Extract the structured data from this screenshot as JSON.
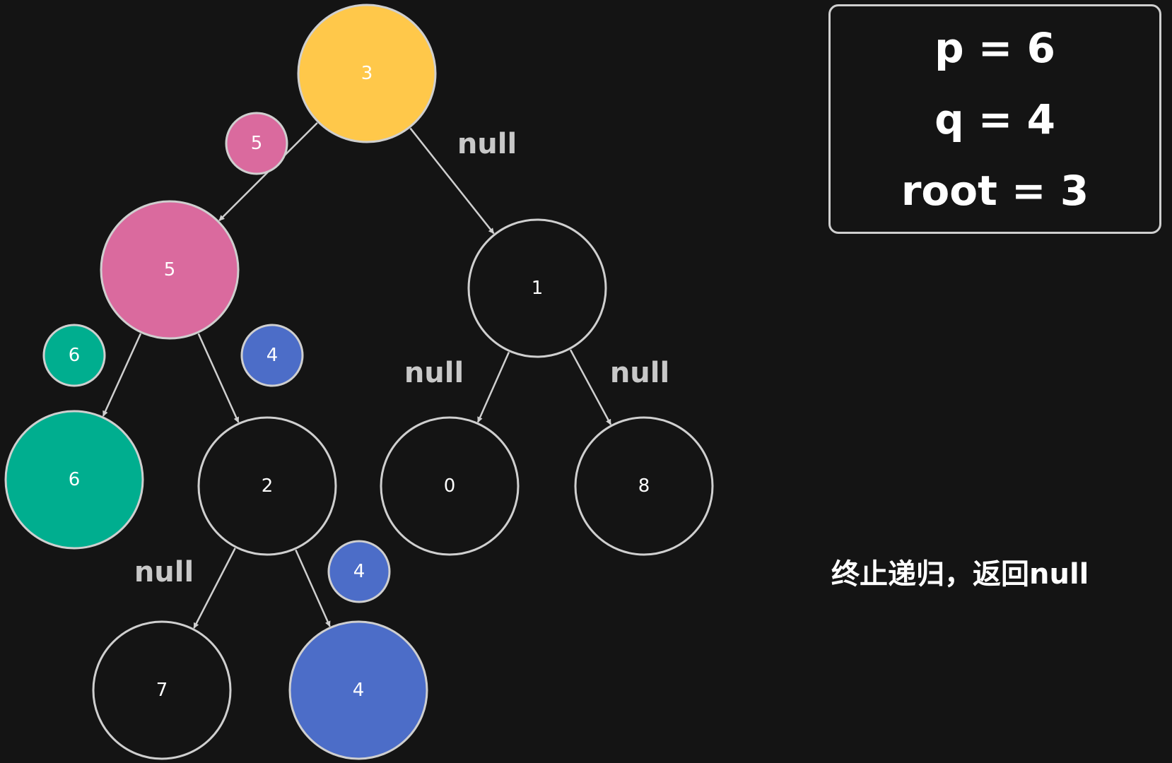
{
  "colors": {
    "background": "#141414",
    "stroke": "#cfcfcf",
    "root_yellow": "#FFC84A",
    "pink": "#DA6A9E",
    "green": "#00AE8F",
    "blue": "#4C6DC8"
  },
  "tree": {
    "nodes": [
      {
        "id": "n3",
        "label": "3",
        "fill": "#FFC84A"
      },
      {
        "id": "n5",
        "label": "5",
        "fill": "#DA6A9E"
      },
      {
        "id": "n1",
        "label": "1",
        "fill": "none"
      },
      {
        "id": "n6",
        "label": "6",
        "fill": "#00AE8F"
      },
      {
        "id": "n2",
        "label": "2",
        "fill": "none"
      },
      {
        "id": "n0",
        "label": "0",
        "fill": "none"
      },
      {
        "id": "n8",
        "label": "8",
        "fill": "none"
      },
      {
        "id": "n7",
        "label": "7",
        "fill": "none"
      },
      {
        "id": "n4",
        "label": "4",
        "fill": "#4C6DC8"
      }
    ],
    "edges": [
      {
        "from": "n3",
        "to": "n5"
      },
      {
        "from": "n3",
        "to": "n1"
      },
      {
        "from": "n5",
        "to": "n6"
      },
      {
        "from": "n5",
        "to": "n2"
      },
      {
        "from": "n1",
        "to": "n0"
      },
      {
        "from": "n1",
        "to": "n8"
      },
      {
        "from": "n2",
        "to": "n7"
      },
      {
        "from": "n2",
        "to": "n4"
      }
    ],
    "badges": [
      {
        "id": "b-3-5",
        "label": "5",
        "fill": "#DA6A9E"
      },
      {
        "id": "b-5-6",
        "label": "6",
        "fill": "#00AE8F"
      },
      {
        "id": "b-5-4",
        "label": "4",
        "fill": "#4C6DC8"
      },
      {
        "id": "b-2-4",
        "label": "4",
        "fill": "#4C6DC8"
      }
    ],
    "null_labels": [
      {
        "id": "null-3-right",
        "label": "null"
      },
      {
        "id": "null-1-left",
        "label": "null"
      },
      {
        "id": "null-1-right",
        "label": "null"
      },
      {
        "id": "null-2-left",
        "label": "null"
      }
    ]
  },
  "info": {
    "p": "p = 6",
    "q": "q = 4",
    "root": "root = 3"
  },
  "status": "终止递归，返回null"
}
